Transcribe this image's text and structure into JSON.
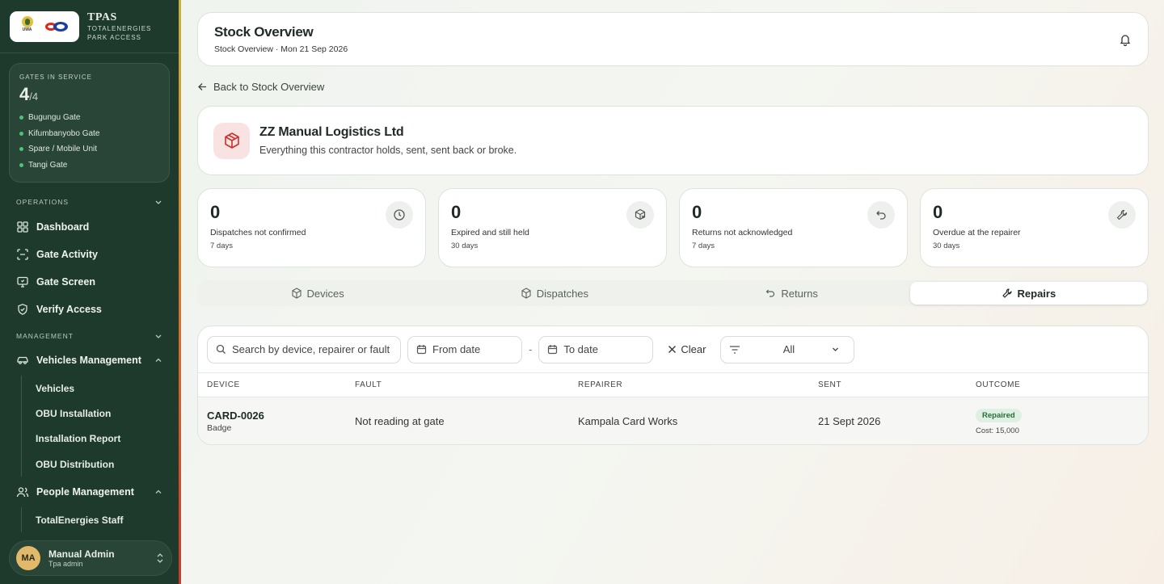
{
  "brand": {
    "title": "TPAS",
    "subtitle_line1": "TOTALENERGIES",
    "subtitle_line2": "PARK ACCESS",
    "uwa_text": "UWA"
  },
  "gates": {
    "label": "GATES IN SERVICE",
    "count": "4",
    "total": "/4",
    "items": [
      "Bugungu Gate",
      "Kifumbanyobo Gate",
      "Spare / Mobile Unit",
      "Tangi Gate"
    ]
  },
  "sidebar": {
    "operations_label": "OPERATIONS",
    "operations": [
      "Dashboard",
      "Gate Activity",
      "Gate Screen",
      "Verify Access"
    ],
    "management_label": "MANAGEMENT",
    "vehicles_management": "Vehicles Management",
    "vehicles_sub": [
      "Vehicles",
      "OBU Installation",
      "Installation Report",
      "OBU Distribution"
    ],
    "people_management": "People Management",
    "people_sub": [
      "TotalEnergies Staff"
    ]
  },
  "user": {
    "initials": "MA",
    "name": "Manual Admin",
    "role": "Tpa admin"
  },
  "header": {
    "title": "Stock Overview",
    "subtitle": "Stock Overview · Mon 21 Sep 2026"
  },
  "back_link": "Back to Stock Overview",
  "contractor": {
    "name": "ZZ Manual Logistics Ltd",
    "description": "Everything this contractor holds, sent, sent back or broke."
  },
  "stats": [
    {
      "value": "0",
      "label": "Dispatches not confirmed",
      "days": "7 days"
    },
    {
      "value": "0",
      "label": "Expired and still held",
      "days": "30 days"
    },
    {
      "value": "0",
      "label": "Returns not acknowledged",
      "days": "7 days"
    },
    {
      "value": "0",
      "label": "Overdue at the repairer",
      "days": "30 days"
    }
  ],
  "tabs": [
    "Devices",
    "Dispatches",
    "Returns",
    "Repairs"
  ],
  "active_tab": "Repairs",
  "filters": {
    "search_placeholder": "Search by device, repairer or fault",
    "from_placeholder": "From date",
    "to_placeholder": "To date",
    "clear_label": "Clear",
    "select_value": "All"
  },
  "table": {
    "columns": [
      "DEVICE",
      "FAULT",
      "REPAIRER",
      "SENT",
      "OUTCOME"
    ],
    "rows": [
      {
        "device": "CARD-0026",
        "device_type": "Badge",
        "fault": "Not reading at gate",
        "repairer": "Kampala Card Works",
        "sent": "21 Sept 2026",
        "outcome": "Repaired",
        "cost": "Cost: 15,000"
      }
    ]
  },
  "colors": {
    "sidebar_bg": "#1e3a2d",
    "accent_red": "#c9332c",
    "status_green": "#4cc47a"
  }
}
